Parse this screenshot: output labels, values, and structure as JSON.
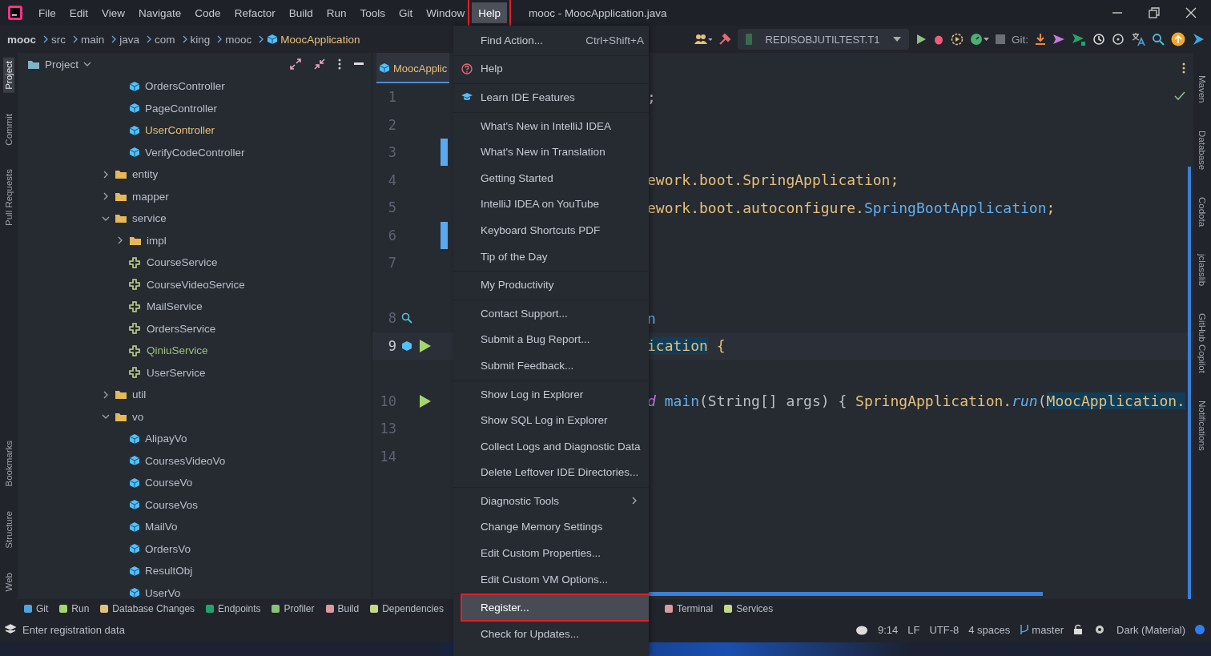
{
  "title_bar": {
    "menus": [
      {
        "label": "File",
        "selected": false,
        "annotated": false
      },
      {
        "label": "Edit",
        "selected": false,
        "annotated": false
      },
      {
        "label": "View",
        "selected": false,
        "annotated": false
      },
      {
        "label": "Navigate",
        "selected": false,
        "annotated": false
      },
      {
        "label": "Code",
        "selected": false,
        "annotated": false
      },
      {
        "label": "Refactor",
        "selected": false,
        "annotated": false
      },
      {
        "label": "Build",
        "selected": false,
        "annotated": false
      },
      {
        "label": "Run",
        "selected": false,
        "annotated": false
      },
      {
        "label": "Tools",
        "selected": false,
        "annotated": false
      },
      {
        "label": "Git",
        "selected": false,
        "annotated": false
      },
      {
        "label": "Window",
        "selected": false,
        "annotated": false
      },
      {
        "label": "Help",
        "selected": true,
        "annotated": true
      }
    ],
    "title": "mooc - MoocApplication.java"
  },
  "nav_bar": {
    "breadcrumbs": [
      "mooc",
      "src",
      "main",
      "java",
      "com",
      "king",
      "mooc",
      "MoocApplication"
    ],
    "run_config": "REDISOBJUTILTEST.T1",
    "git_label": "Git:"
  },
  "left_strip": {
    "top": [
      {
        "label": "Project",
        "selected": true
      },
      {
        "label": "Commit",
        "selected": false
      },
      {
        "label": "Pull Requests",
        "selected": false
      }
    ],
    "bottom": [
      {
        "label": "Bookmarks",
        "selected": false
      },
      {
        "label": "Structure",
        "selected": false
      },
      {
        "label": "Web",
        "selected": false
      }
    ]
  },
  "project_panel": {
    "title": "Project",
    "tree": [
      {
        "children": [
          {
            "label": "OrdersController",
            "kind": "class",
            "color": "#b8bfc9"
          },
          {
            "label": "PageController",
            "kind": "class",
            "color": "#b8bfc9"
          },
          {
            "label": "UserController",
            "kind": "class",
            "color": "#e5c07b"
          },
          {
            "label": "VerifyCodeController",
            "kind": "class",
            "color": "#b8bfc9"
          }
        ]
      },
      {
        "label": "entity",
        "kind": "folder",
        "color": "#b8bfc9",
        "expanded": false
      },
      {
        "label": "mapper",
        "kind": "folder",
        "color": "#b8bfc9",
        "expanded": false
      },
      {
        "label": "service",
        "kind": "folder",
        "color": "#b8bfc9",
        "expanded": true,
        "children": [
          {
            "label": "impl",
            "kind": "folder",
            "color": "#b8bfc9",
            "expanded": false
          },
          {
            "label": "CourseService",
            "kind": "interface",
            "color": "#b8bfc9"
          },
          {
            "label": "CourseVideoService",
            "kind": "interface",
            "color": "#b8bfc9"
          },
          {
            "label": "MailService",
            "kind": "interface",
            "color": "#b8bfc9"
          },
          {
            "label": "OrdersService",
            "kind": "interface",
            "color": "#b8bfc9"
          },
          {
            "label": "QiniuService",
            "kind": "interface",
            "color": "#98c379"
          },
          {
            "label": "UserService",
            "kind": "interface",
            "color": "#b8bfc9"
          }
        ]
      },
      {
        "label": "util",
        "kind": "folder",
        "color": "#b8bfc9",
        "expanded": false
      },
      {
        "label": "vo",
        "kind": "folder",
        "color": "#b8bfc9",
        "expanded": true,
        "children": [
          {
            "label": "AlipayVo",
            "kind": "class",
            "color": "#b8bfc9"
          },
          {
            "label": "CoursesVideoVo",
            "kind": "class",
            "color": "#b8bfc9"
          },
          {
            "label": "CourseVo",
            "kind": "class",
            "color": "#b8bfc9"
          },
          {
            "label": "CourseVos",
            "kind": "class",
            "color": "#b8bfc9"
          },
          {
            "label": "MailVo",
            "kind": "class",
            "color": "#b8bfc9"
          },
          {
            "label": "OrdersVo",
            "kind": "class",
            "color": "#b8bfc9"
          },
          {
            "label": "ResultObj",
            "kind": "class",
            "color": "#b8bfc9"
          },
          {
            "label": "UserVo",
            "kind": "class",
            "color": "#b8bfc9"
          }
        ]
      }
    ]
  },
  "editor": {
    "tab": {
      "label": "MoocApplic",
      "selected": true
    },
    "lines": [
      {
        "kind": "code",
        "number": "1",
        "changed": false,
        "tokens": [
          {
            "text": ";",
            "kind": "text"
          }
        ]
      },
      {
        "kind": "code",
        "number": "2",
        "changed": false
      },
      {
        "kind": "code",
        "number": "3",
        "changed": true
      },
      {
        "kind": "code",
        "number": "4",
        "changed": false,
        "tokens": [
          {
            "text": "ework.boot.SpringApplication;",
            "kind": "plain"
          }
        ]
      },
      {
        "kind": "code",
        "number": "5",
        "changed": false,
        "tokens": [
          {
            "text": "ework.boot.autoconfigure.",
            "kind": "plain"
          },
          {
            "text": "SpringBootApplication",
            "kind": "type"
          },
          {
            "text": ";",
            "kind": "plain"
          }
        ]
      },
      {
        "kind": "code",
        "number": "6",
        "changed": true
      },
      {
        "kind": "code",
        "number": "7",
        "changed": false
      },
      {
        "kind": "blank"
      },
      {
        "kind": "code",
        "number": "8",
        "changed": false,
        "usages": true,
        "tokens": [
          {
            "text": "n",
            "kind": "type"
          }
        ]
      },
      {
        "kind": "code",
        "number": "9",
        "changed": false,
        "class_run": true,
        "current": true,
        "tokens": [
          {
            "text": "ication",
            "kind": "match"
          },
          {
            "text": " {",
            "kind": "plain"
          }
        ]
      },
      {
        "kind": "blank"
      },
      {
        "kind": "code",
        "number": "10",
        "changed": false,
        "run": true,
        "tokens": [
          {
            "text": "d",
            "kind": "keyword"
          },
          {
            "text": " main",
            "kind": "type"
          },
          {
            "text": "(String[] args) { ",
            "kind": "text"
          },
          {
            "text": "SpringApplication.",
            "kind": "plain"
          },
          {
            "text": "run",
            "kind": "call"
          },
          {
            "text": "(",
            "kind": "text"
          },
          {
            "text": "MoocApplication.",
            "kind": "match"
          }
        ]
      },
      {
        "kind": "code",
        "number": "13",
        "changed": false
      },
      {
        "kind": "code",
        "number": "14",
        "changed": false
      }
    ]
  },
  "right_strip": [
    "Maven",
    "Database",
    "Codota",
    "jclasslib",
    "GitHub Copilot",
    "Notifications"
  ],
  "help_menu": {
    "groups": [
      [
        {
          "label": "Find Action...",
          "shortcut": "Ctrl+Shift+A",
          "selected": false
        }
      ],
      [
        {
          "label": "Help",
          "selected": false
        }
      ],
      [
        {
          "label": "Learn IDE Features",
          "selected": false
        }
      ],
      [
        {
          "label": "What's New in IntelliJ IDEA",
          "selected": false
        },
        {
          "label": "What's New in Translation",
          "selected": false
        },
        {
          "label": "Getting Started",
          "selected": false
        },
        {
          "label": "IntelliJ IDEA on YouTube",
          "selected": false
        },
        {
          "label": "Keyboard Shortcuts PDF",
          "selected": false
        },
        {
          "label": "Tip of the Day",
          "selected": false
        }
      ],
      [
        {
          "label": "My Productivity",
          "selected": false
        }
      ],
      [
        {
          "label": "Contact Support...",
          "selected": false
        },
        {
          "label": "Submit a Bug Report...",
          "selected": false
        },
        {
          "label": "Submit Feedback...",
          "selected": false
        }
      ],
      [
        {
          "label": "Show Log in Explorer",
          "selected": false
        },
        {
          "label": "Show SQL Log in Explorer",
          "selected": false
        },
        {
          "label": "Collect Logs and Diagnostic Data",
          "selected": false
        },
        {
          "label": "Delete Leftover IDE Directories...",
          "selected": false
        }
      ],
      [
        {
          "label": "Diagnostic Tools",
          "selected": false,
          "submenu": true
        },
        {
          "label": "Change Memory Settings",
          "selected": false
        },
        {
          "label": "Edit Custom Properties...",
          "selected": false
        },
        {
          "label": "Edit Custom VM Options...",
          "selected": false
        }
      ],
      [
        {
          "label": "Register...",
          "selected": true,
          "annotated": true
        },
        {
          "label": "Check for Updates...",
          "selected": false
        }
      ]
    ]
  },
  "tool_window_bar": {
    "left": [
      "Git",
      "Run",
      "Database Changes",
      "Endpoints",
      "Profiler",
      "Build",
      "Dependencies"
    ],
    "right": [
      "Terminal",
      "Services"
    ]
  },
  "status_bar": {
    "message": "Enter registration data",
    "items": [
      "9:14",
      "LF",
      "UTF-8",
      "4 spaces"
    ],
    "branch": "master",
    "theme": "Dark (Material)"
  }
}
